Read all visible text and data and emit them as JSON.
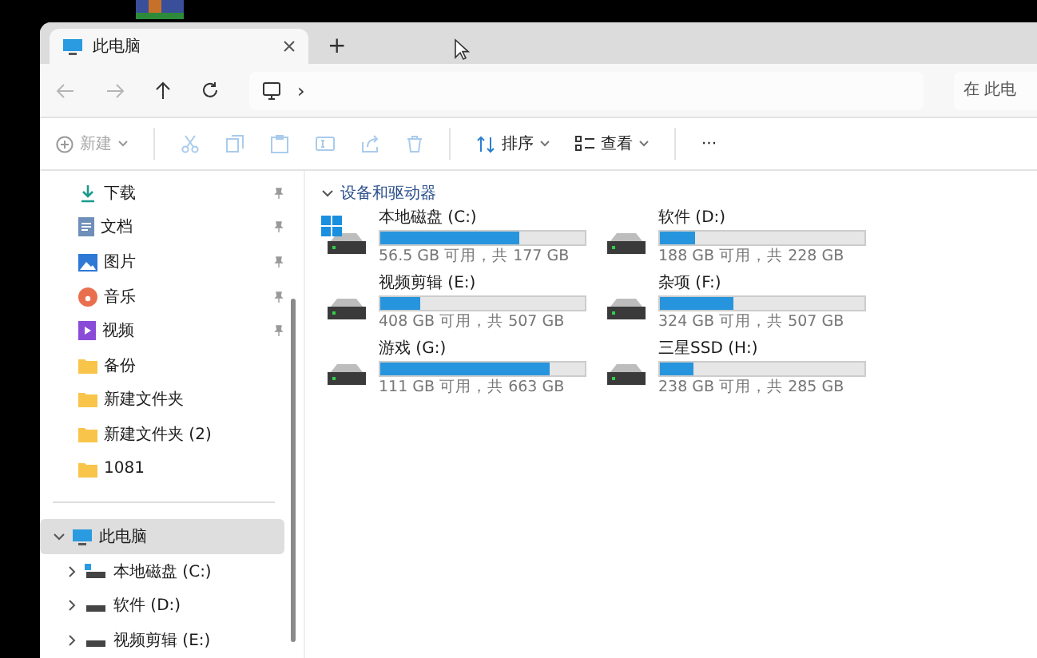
{
  "tabs": [
    {
      "title": "此电脑",
      "selected": true
    }
  ],
  "new_tab": "+",
  "address": {
    "separator": "›"
  },
  "search": {
    "placeholder": "在 此电"
  },
  "toolbar": {
    "new": {
      "label": "新建",
      "disabled": true
    },
    "actions": [
      {
        "kind": "cut",
        "disabled": true
      },
      {
        "kind": "copy",
        "disabled": true
      },
      {
        "kind": "paste",
        "disabled": true
      },
      {
        "kind": "rename",
        "disabled": true
      },
      {
        "kind": "share",
        "disabled": true
      },
      {
        "kind": "delete",
        "disabled": true
      }
    ],
    "sort": "排序",
    "view": "查看",
    "more": "···"
  },
  "sidebar": {
    "quick_access": [
      {
        "label": "下载",
        "kind": "download",
        "pinned": true
      },
      {
        "label": "文档",
        "kind": "document",
        "pinned": true
      },
      {
        "label": "图片",
        "kind": "picture",
        "pinned": true
      },
      {
        "label": "音乐",
        "kind": "music",
        "pinned": true
      },
      {
        "label": "视频",
        "kind": "video",
        "pinned": true
      },
      {
        "label": "备份",
        "kind": "folder",
        "pinned": false
      },
      {
        "label": "新建文件夹",
        "kind": "folder",
        "pinned": false
      },
      {
        "label": "新建文件夹 (2)",
        "kind": "folder",
        "pinned": false
      },
      {
        "label": "1081",
        "kind": "folder",
        "pinned": false
      }
    ],
    "tree": [
      {
        "label": "此电脑",
        "kind": "pc",
        "expanded": true,
        "selected": true,
        "children": [
          {
            "label": "本地磁盘 (C:)",
            "kind": "system-drive",
            "expanded": false,
            "selected": false
          },
          {
            "label": "软件 (D:)",
            "kind": "drive",
            "expanded": false,
            "selected": false
          },
          {
            "label": "视频剪辑 (E:)",
            "kind": "drive",
            "expanded": false,
            "selected": false
          }
        ]
      }
    ]
  },
  "section": {
    "title": "设备和驱动器",
    "expanded": true
  },
  "drives": [
    {
      "name": "本地磁盘 (C:)",
      "system": true,
      "level": 0.68,
      "space": "56.5 GB 可用，共 177 GB"
    },
    {
      "name": "软件 (D:)",
      "system": false,
      "level": 0.175,
      "space": "188 GB 可用，共 228 GB"
    },
    {
      "name": "视频剪辑 (E:)",
      "system": false,
      "level": 0.195,
      "space": "408 GB 可用，共 507 GB"
    },
    {
      "name": "杂项 (F:)",
      "system": false,
      "level": 0.36,
      "space": "324 GB 可用，共 507 GB"
    },
    {
      "name": "游戏 (G:)",
      "system": false,
      "level": 0.83,
      "space": "111 GB 可用，共 663 GB"
    },
    {
      "name": "三星SSD (H:)",
      "system": false,
      "level": 0.165,
      "space": "238 GB 可用，共 285 GB"
    }
  ]
}
